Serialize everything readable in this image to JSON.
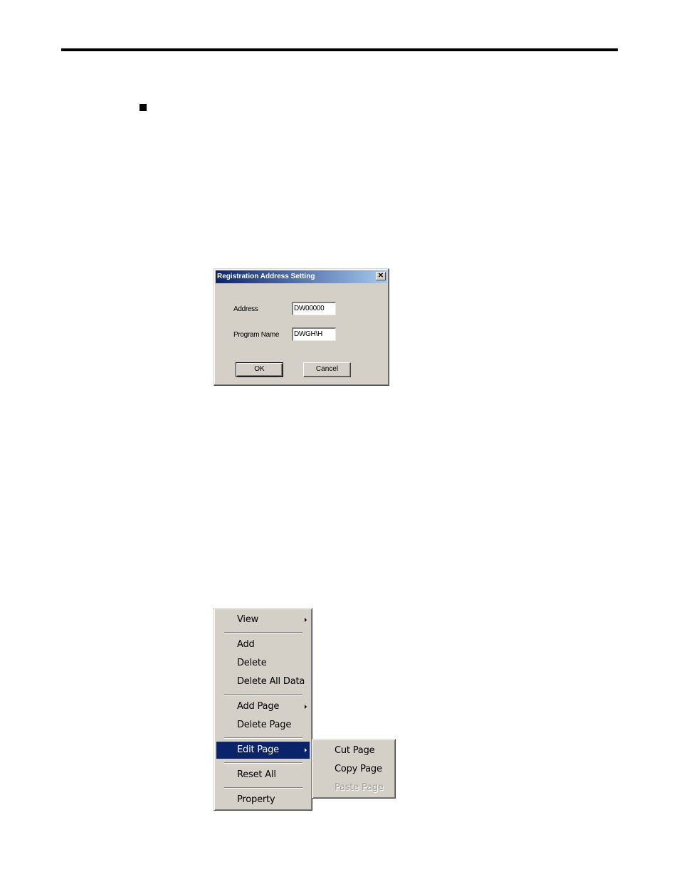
{
  "page": {
    "bullet_icon": "square-bullet-icon"
  },
  "dialog": {
    "title": "Registration Address Setting",
    "close_glyph": "✕",
    "fields": [
      {
        "label": "Address",
        "value": "DW00000"
      },
      {
        "label": "Program Name",
        "value": "DWGH\\H"
      }
    ],
    "ok_label": "OK",
    "cancel_label": "Cancel"
  },
  "context_menu": {
    "items": [
      {
        "label": "View",
        "mnemonic": "V",
        "submenu": true
      },
      {
        "separator": true
      },
      {
        "label": "Add",
        "mnemonic": "A"
      },
      {
        "label": "Delete",
        "mnemonic": "D"
      },
      {
        "label": "Delete All Data",
        "mnemonic": "l"
      },
      {
        "separator": true
      },
      {
        "label": "Add Page",
        "mnemonic": "g",
        "submenu": true
      },
      {
        "label": "Delete Page",
        "mnemonic": "e"
      },
      {
        "separator": true
      },
      {
        "label": "Edit Page",
        "mnemonic": "P",
        "submenu": true,
        "highlighted": true
      },
      {
        "separator": true
      },
      {
        "label": "Reset All",
        "mnemonic": "R"
      },
      {
        "separator": true
      },
      {
        "label": "Property",
        "mnemonic": "P"
      }
    ],
    "submenu_edit_page": [
      {
        "label": "Cut Page",
        "mnemonic": "t"
      },
      {
        "label": "Copy Page",
        "mnemonic": "C"
      },
      {
        "label": "Paste Page",
        "mnemonic": "P",
        "disabled": true
      }
    ],
    "highlight_color": "#0a246a",
    "menu_bg": "#d4d0c8"
  }
}
